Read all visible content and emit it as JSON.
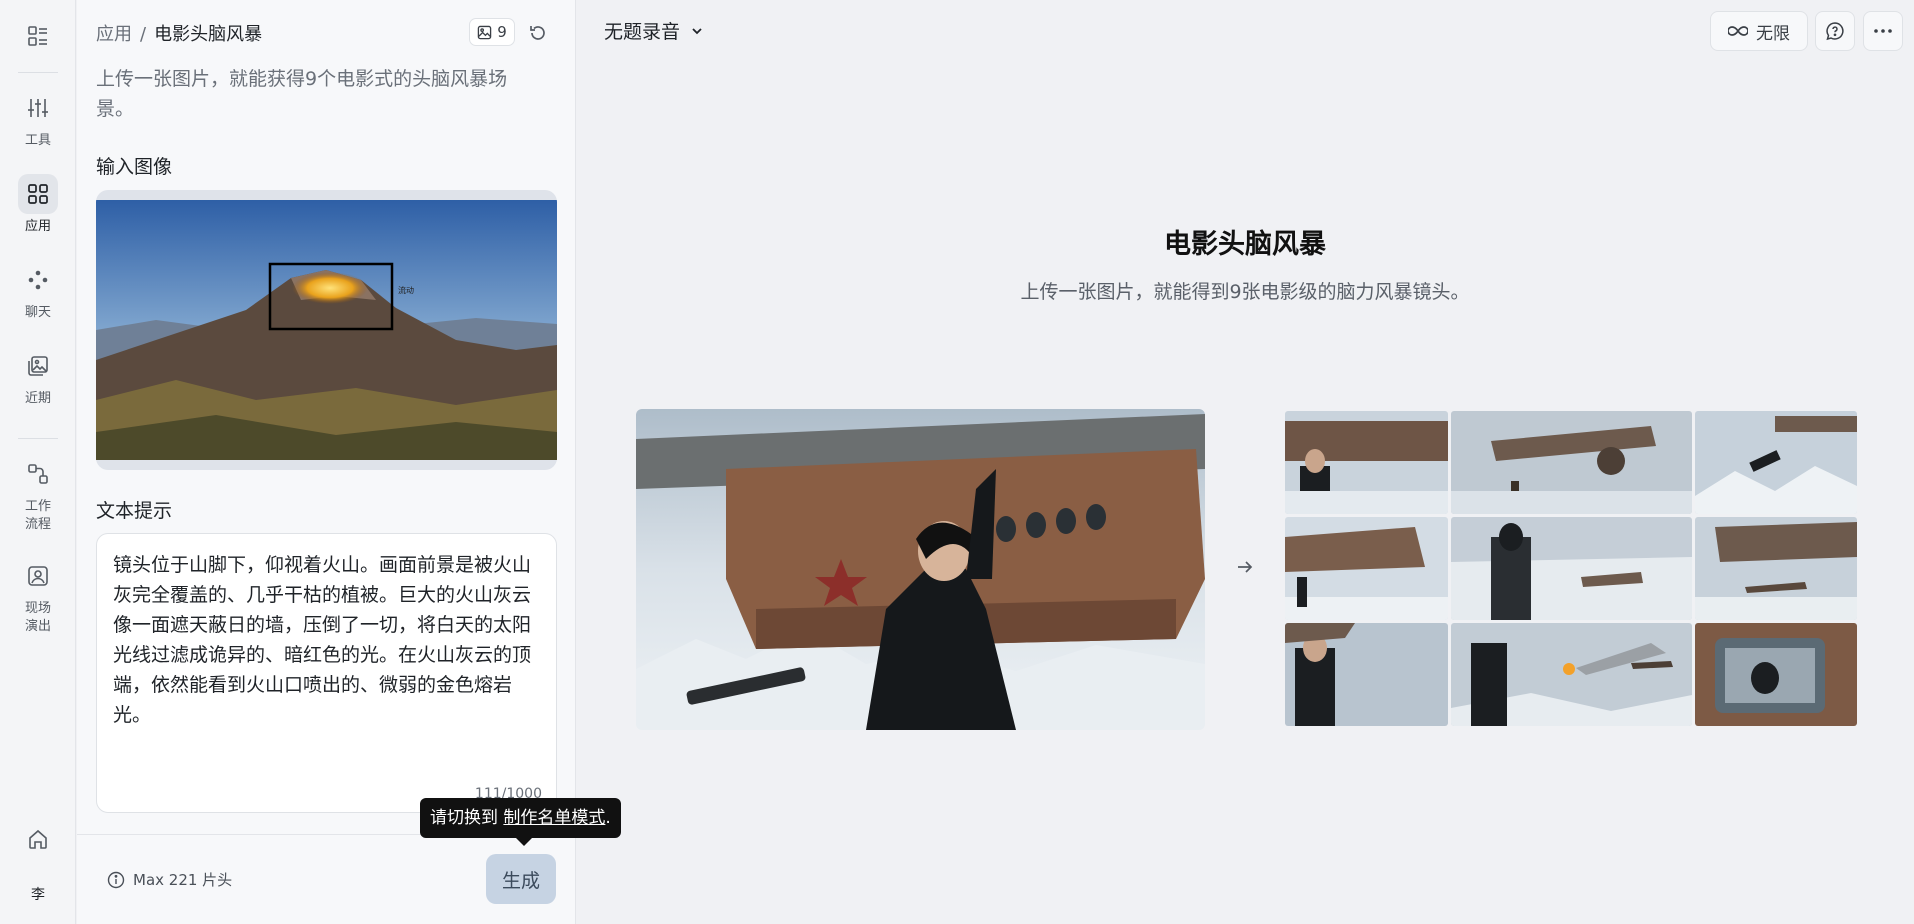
{
  "rail": {
    "items": [
      {
        "label": "工具",
        "icon": "sliders-icon"
      },
      {
        "label": "应用",
        "icon": "apps-grid-icon"
      },
      {
        "label": "聊天",
        "icon": "chat-dots-icon"
      },
      {
        "label": "近期",
        "icon": "recent-images-icon"
      },
      {
        "label": "工作流程",
        "line1": "工作",
        "line2": "流程",
        "icon": "workflow-icon"
      },
      {
        "label": "现场演出",
        "line1": "现场",
        "line2": "演出",
        "icon": "live-portrait-icon"
      }
    ],
    "avatar": "李"
  },
  "panel": {
    "breadcrumb_root": "应用",
    "breadcrumb_sep": "/",
    "breadcrumb_current": "电影头脑风暴",
    "image_count": "9",
    "description": "上传一张图片，就能获得9个电影式的头脑风暴场景。",
    "input_image_label": "输入图像",
    "annotation_label": "流动",
    "text_prompt_label": "文本提示",
    "prompt_value": "镜头位于山脚下，仰视着火山。画面前景是被火山灰完全覆盖的、几乎干枯的植被。巨大的火山灰云像一面遮天蔽日的墙，压倒了一切，将白天的太阳光线过滤成诡异的、暗红色的光。在火山灰云的顶端，依然能看到火山口喷出的、微弱的金色熔岩光。",
    "char_count": "111/1000",
    "max_info": "Max 221 片头",
    "generate_label": "生成",
    "tooltip_prefix": "请切换到 ",
    "tooltip_link": "制作名单模式",
    "tooltip_suffix": "."
  },
  "topbar": {
    "title": "无题录音",
    "unlimited_label": "无限"
  },
  "hero": {
    "title": "电影头脑风暴",
    "subtitle": "上传一张图片，就能得到9张电影级的脑力风暴镜头。"
  },
  "colors": {
    "accent_button": "#c6d3e3",
    "tooltip_bg": "#111111",
    "background": "#f0f1f4"
  }
}
